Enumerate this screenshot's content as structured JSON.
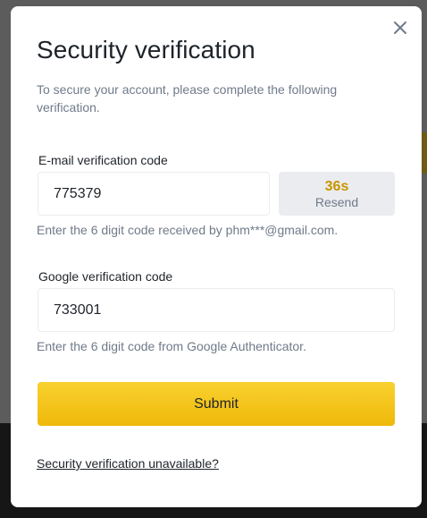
{
  "modal": {
    "title": "Security verification",
    "subtitle": "To secure your account, please complete the following verification."
  },
  "email": {
    "label": "E-mail verification code",
    "value": "775379",
    "hint": "Enter the 6 digit code received by phm***@gmail.com.",
    "resend_countdown": "36s",
    "resend_label": "Resend"
  },
  "google": {
    "label": "Google verification code",
    "value": "733001",
    "hint": "Enter the 6 digit code from Google Authenticator."
  },
  "actions": {
    "submit_label": "Submit",
    "help_link": "Security verification unavailable?"
  },
  "colors": {
    "accent": "#f0b90b",
    "countdown": "#c99400",
    "text_primary": "#1e2329",
    "text_secondary": "#707a8a"
  },
  "icons": {
    "close": "close-icon"
  }
}
